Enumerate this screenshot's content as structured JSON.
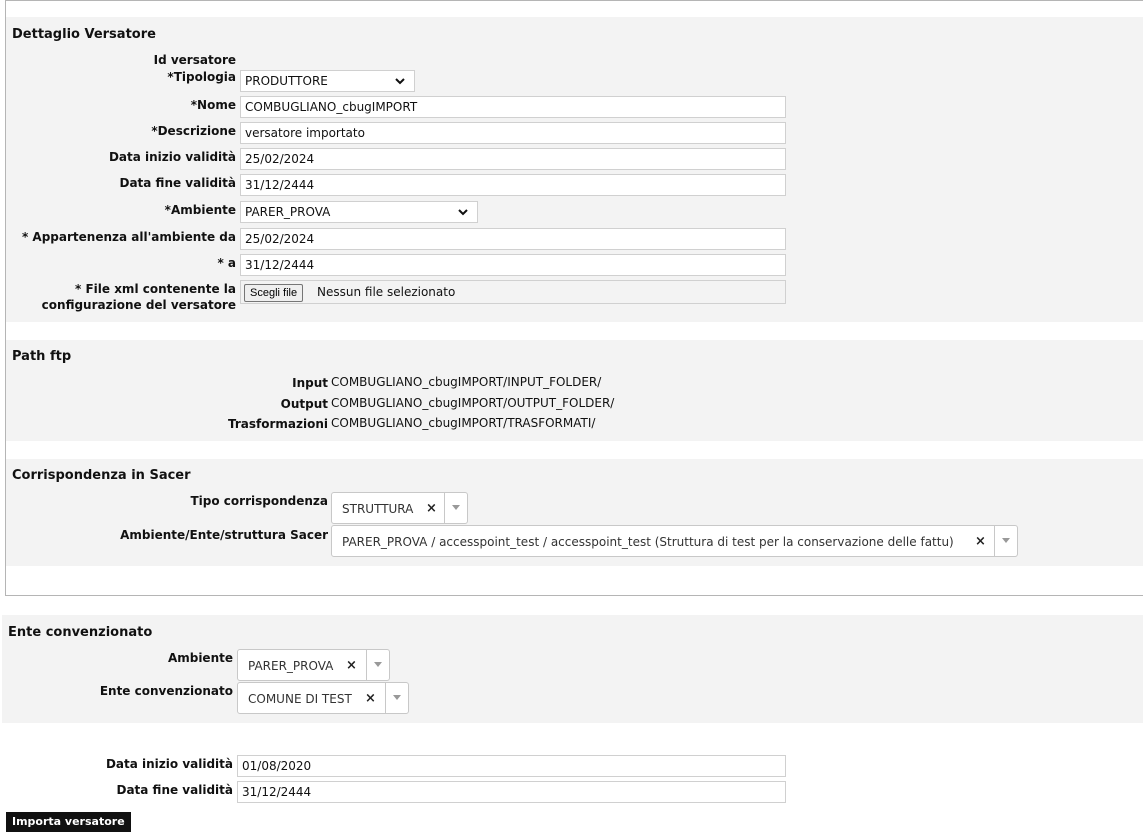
{
  "dettaglio": {
    "title": "Dettaglio Versatore",
    "id_label": "Id versatore",
    "tipologia_label": "*Tipologia",
    "tipologia_value": "PRODUTTORE",
    "nome_label": "*Nome",
    "nome_value": "COMBUGLIANO_cbugIMPORT",
    "descrizione_label": "*Descrizione",
    "descrizione_value": "versatore importato",
    "data_inizio_label": "Data inizio validità",
    "data_inizio_value": "25/02/2024",
    "data_fine_label": "Data fine validità",
    "data_fine_value": "31/12/2444",
    "ambiente_label": "*Ambiente",
    "ambiente_value": "PARER_PROVA",
    "appartenenza_da_label": "* Appartenenza all'ambiente da",
    "appartenenza_da_value": "25/02/2024",
    "appartenenza_a_label": "* a",
    "appartenenza_a_value": "31/12/2444",
    "file_label_line1": "* File xml contenente la",
    "file_label_line2": "configurazione del versatore",
    "file_button": "Scegli file",
    "file_status": "Nessun file selezionato"
  },
  "path_ftp": {
    "title": "Path ftp",
    "input_label": "Input",
    "input_value": "COMBUGLIANO_cbugIMPORT/INPUT_FOLDER/",
    "output_label": "Output",
    "output_value": "COMBUGLIANO_cbugIMPORT/OUTPUT_FOLDER/",
    "trasf_label": "Trasformazioni",
    "trasf_value": "COMBUGLIANO_cbugIMPORT/TRASFORMATI/"
  },
  "corrispondenza": {
    "title": "Corrispondenza in Sacer",
    "tipo_label": "Tipo corrispondenza",
    "tipo_value": "STRUTTURA",
    "struttura_label": "Ambiente/Ente/struttura Sacer",
    "struttura_value": "PARER_PROVA / accesspoint_test / accesspoint_test (Struttura di test per la conservazione delle fattu)"
  },
  "ente": {
    "title": "Ente convenzionato",
    "ambiente_label": "Ambiente",
    "ambiente_value": "PARER_PROVA",
    "ente_label": "Ente convenzionato",
    "ente_value": "COMUNE DI TEST"
  },
  "validita": {
    "data_inizio_label": "Data inizio validità",
    "data_inizio_value": "01/08/2020",
    "data_fine_label": "Data fine validità",
    "data_fine_value": "31/12/2444"
  },
  "actions": {
    "importa_label": "Importa versatore"
  },
  "icons": {
    "chevron": "chevron-down-icon",
    "clear": "clear-x-icon",
    "dropdown": "dropdown-arrow-icon"
  }
}
